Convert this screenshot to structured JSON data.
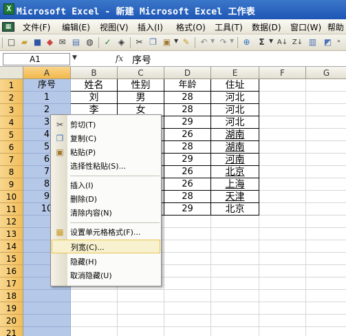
{
  "window": {
    "title": "Microsoft Excel - 新建 Microsoft Excel 工作表",
    "icon": "excel-app-icon"
  },
  "menu": [
    {
      "label": "文件(F)"
    },
    {
      "label": "编辑(E)"
    },
    {
      "label": "视图(V)"
    },
    {
      "label": "插入(I)"
    },
    {
      "label": "格式(O)"
    },
    {
      "label": "工具(T)"
    },
    {
      "label": "数据(D)"
    },
    {
      "label": "窗口(W)"
    },
    {
      "label": "帮助"
    }
  ],
  "toolbar": {
    "icons": [
      "new-icon",
      "open-icon",
      "save-icon",
      "permission-icon",
      "email-icon",
      "print-icon",
      "print-preview-icon",
      "spelling-icon",
      "research-icon",
      "cut-icon",
      "copy-icon",
      "paste-icon",
      "format-painter-icon",
      "undo-icon",
      "redo-icon",
      "hyperlink-icon",
      "autosum-icon",
      "sort-ascending-icon",
      "sort-descending-icon"
    ]
  },
  "formula_bar": {
    "name_box": "A1",
    "fx": "fx",
    "content": "序号"
  },
  "columns": [
    "A",
    "B",
    "C",
    "D",
    "E",
    "F",
    "G"
  ],
  "rows": [
    "1",
    "2",
    "3",
    "4",
    "5",
    "6",
    "7",
    "8",
    "9",
    "10",
    "11",
    "12",
    "13",
    "14",
    "15",
    "16",
    "17",
    "18",
    "19",
    "20",
    "21"
  ],
  "cells": {
    "A": [
      "序号",
      "1",
      "2",
      "3",
      "4",
      "5",
      "6",
      "7",
      "8",
      "9",
      "10"
    ],
    "B": [
      "姓名",
      "刘",
      "李"
    ],
    "C": [
      "性别",
      "男",
      "女"
    ],
    "D": [
      "年龄",
      "28",
      "28",
      "29",
      "26",
      "28",
      "29",
      "26",
      "26",
      "28",
      "29"
    ],
    "E": [
      "住址",
      "河北",
      "河北",
      "河北",
      "湖南",
      "湖南",
      "河南",
      "北京",
      "上海",
      "天津",
      "北京"
    ]
  },
  "context_menu": {
    "items": [
      {
        "label": "剪切(T)",
        "icon": "scissors-icon"
      },
      {
        "label": "复制(C)",
        "icon": "copy-icon"
      },
      {
        "label": "粘贴(P)",
        "icon": "paste-icon"
      },
      {
        "label": "选择性粘贴(S)...",
        "icon": ""
      },
      {
        "label": "插入(I)",
        "icon": ""
      },
      {
        "label": "删除(D)",
        "icon": ""
      },
      {
        "label": "清除内容(N)",
        "icon": ""
      },
      {
        "label": "设置单元格格式(F)...",
        "icon": "format-cells-icon"
      },
      {
        "label": "列宽(C)...",
        "icon": "",
        "highlighted": true
      },
      {
        "label": "隐藏(H)",
        "icon": ""
      },
      {
        "label": "取消隐藏(U)",
        "icon": ""
      }
    ]
  },
  "colors": {
    "title_bar": "#1f56b5",
    "selection": "#b6c8e8",
    "header_selected": "#f2bd58",
    "menu_highlight": "#f7f1cf"
  }
}
